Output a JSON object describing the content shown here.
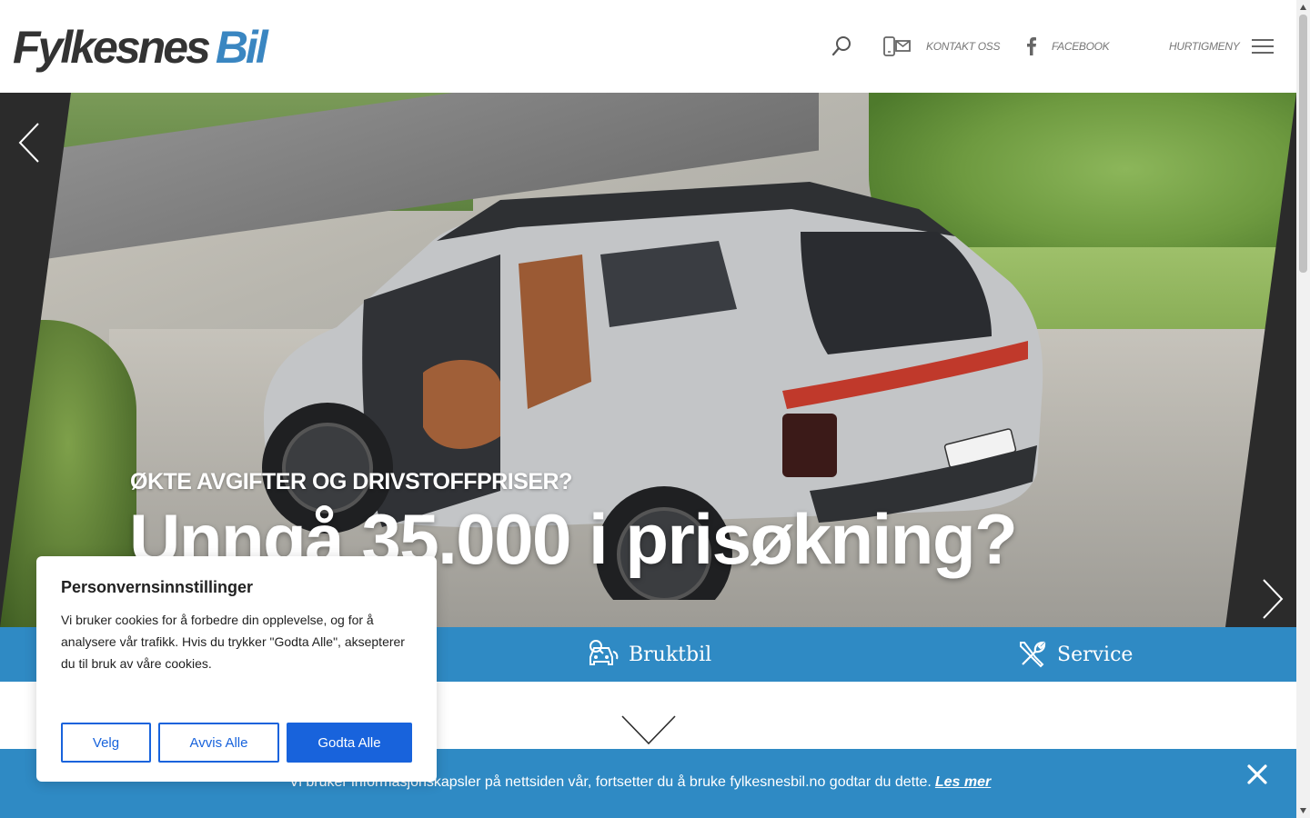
{
  "header": {
    "logo_part1": "Fylkesnes",
    "logo_part2": "Bil",
    "contact_label": "KONTAKT OSS",
    "facebook_label": "FACEBOOK",
    "quick_menu_label": "HURTIGMENY"
  },
  "hero": {
    "subtitle": "ØKTE AVGIFTER OG DRIVSTOFFPRISER?",
    "title": "Unngå 35.000 i prisøkning?"
  },
  "nav": {
    "bruktbil": "Bruktbil",
    "service": "Service"
  },
  "cookie_bar": {
    "text": "Vi bruker informasjonskapsler på nettsiden vår, fortsetter du å bruke fylkesnesbil.no godtar du dette.",
    "link": "Les mer"
  },
  "consent": {
    "title": "Personvernsinnstillinger",
    "body": "Vi bruker cookies for å forbedre din opplevelse, og for å analysere vår trafikk. Hvis du trykker \"Godta Alle\", aksepterer du til bruk av våre cookies.",
    "velg": "Velg",
    "avvis": "Avvis Alle",
    "godta": "Godta Alle"
  },
  "colors": {
    "brand_blue": "#2f8ac4",
    "logo_blue": "#3a86c1",
    "consent_blue": "#1863dc"
  },
  "icons": [
    "search-icon",
    "phone-mail-icon",
    "facebook-icon",
    "hamburger-icon",
    "chevron-left-icon",
    "chevron-right-icon",
    "car-search-icon",
    "wrench-icon",
    "chevron-down-icon",
    "close-icon"
  ]
}
